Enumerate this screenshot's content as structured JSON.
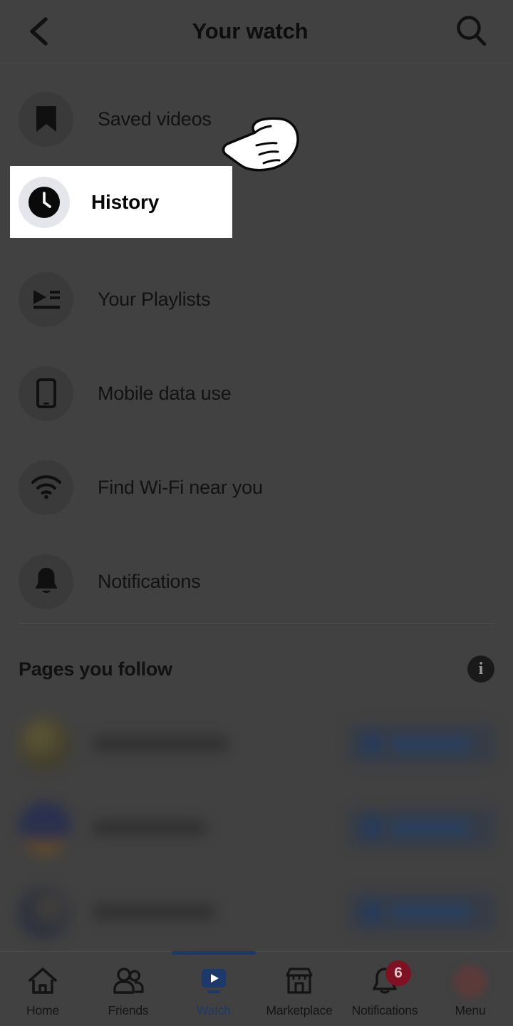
{
  "header": {
    "title": "Your watch",
    "back_icon": "chevron-left-icon",
    "search_icon": "search-icon"
  },
  "menu": {
    "items": [
      {
        "label": "Saved videos",
        "icon": "bookmark-icon",
        "highlighted": false
      },
      {
        "label": "History",
        "icon": "clock-icon",
        "highlighted": true
      },
      {
        "label": "Your Playlists",
        "icon": "playlist-icon",
        "highlighted": false
      },
      {
        "label": "Mobile data use",
        "icon": "mobile-phone-icon",
        "highlighted": false
      },
      {
        "label": "Find Wi-Fi near you",
        "icon": "wifi-icon",
        "highlighted": false
      },
      {
        "label": "Notifications",
        "icon": "bell-icon",
        "highlighted": false
      }
    ]
  },
  "pages_section": {
    "title": "Pages you follow",
    "info_icon": "info-icon",
    "info_glyph": "i",
    "rows": [
      {
        "name_obscured": true,
        "avatar_color": "#4a4328",
        "follow_button_obscured": true,
        "name_width": 190
      },
      {
        "name_obscured": true,
        "avatar_color": "#24305c",
        "follow_button_obscured": true,
        "name_width": 160
      },
      {
        "name_obscured": true,
        "avatar_color": "#2b2f3a",
        "follow_button_obscured": true,
        "name_width": 172
      }
    ]
  },
  "bottom_nav": {
    "active_tab": "Watch",
    "items": [
      {
        "label": "Home",
        "icon": "home-icon",
        "active": false,
        "badge": null
      },
      {
        "label": "Friends",
        "icon": "friends-icon",
        "active": false,
        "badge": null
      },
      {
        "label": "Watch",
        "icon": "watch-video-icon",
        "active": true,
        "badge": null
      },
      {
        "label": "Marketplace",
        "icon": "storefront-icon",
        "active": false,
        "badge": null
      },
      {
        "label": "Notifications",
        "icon": "bell-icon",
        "active": false,
        "badge": "6"
      },
      {
        "label": "Menu",
        "icon": "avatar-icon",
        "active": false,
        "badge": null
      }
    ]
  },
  "overlay": {
    "cursor_icon": "pointing-hand-cursor",
    "spotlight_target": "History",
    "dim_color": "#414141",
    "spotlight_bg": "#ffffff",
    "accent_color": "#1b3a6b",
    "badge_color": "#7e1122"
  }
}
